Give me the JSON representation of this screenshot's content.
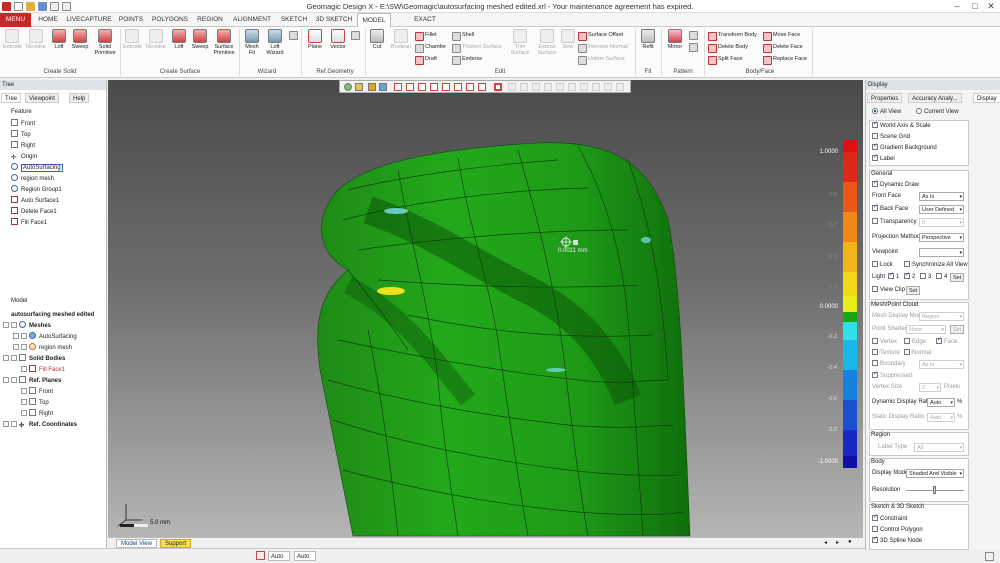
{
  "app": {
    "title": "Geomagic Design X - E:\\SW\\Geomagic\\autosurfacing meshed edited.xrl - Your maintenance agreement has expired."
  },
  "tabs": [
    "MENU",
    "HOME",
    "LIVECAPTURE",
    "POINTS",
    "POLYGONS",
    "REGION",
    "ALIGNMENT",
    "SKETCH",
    "3D SKETCH",
    "MODEL",
    "EXACT SURFACING"
  ],
  "active_tab": "MODEL",
  "ribbon": {
    "create_solid": {
      "label": "Create Solid",
      "buttons": [
        "Extrude",
        "Revolve",
        "Loft",
        "Sweep",
        "Solid Primitive"
      ]
    },
    "create_surface": {
      "label": "Create Surface",
      "buttons": [
        "Extrude",
        "Revolve",
        "Loft",
        "Sweep",
        "Surface Primitive"
      ]
    },
    "wizard": {
      "label": "Wizard",
      "buttons": [
        "Mesh Fit",
        "Loft Wizard"
      ]
    },
    "refgeo": {
      "label": "Ref.Geometry",
      "buttons": [
        "Plane",
        "Vector"
      ]
    },
    "edit": {
      "label": "Edit",
      "big": [
        "Cut",
        "Boolean",
        "Trim Surface",
        "Extend Surface",
        "Sew"
      ],
      "small": [
        "Fillet",
        "Chamfer",
        "Draft",
        "Shell",
        "Thicken Surface",
        "Emboss",
        "Surface Offset",
        "Remove Normal",
        "Untrim Surface"
      ]
    },
    "fit": {
      "label": "Fit",
      "buttons": [
        "Refit"
      ]
    },
    "pattern": {
      "label": "Pattern",
      "buttons": [
        "Mirror"
      ]
    },
    "bodyface": {
      "label": "Body/Face",
      "small": [
        "Transform Body",
        "Delete Body",
        "Split Face",
        "Move Face",
        "Delete Face",
        "Replace Face"
      ]
    }
  },
  "left_panel": {
    "header": "Tree",
    "tabs": [
      "Tree",
      "Viewpoint",
      "Help"
    ],
    "feature_title": "Feature",
    "features": [
      "Front",
      "Top",
      "Right",
      "Origin",
      "AutoSurfacing",
      "region mesh",
      "Region Group1",
      "Auto Surface1",
      "Delete Face1",
      "Fill Face1"
    ],
    "model_title": "Model",
    "model_root": "autosurfacing meshed edited",
    "model": [
      {
        "label": "Meshes",
        "level": 1
      },
      {
        "label": "AutoSurfacing",
        "level": 2
      },
      {
        "label": "region mesh",
        "level": 2
      },
      {
        "label": "Solid Bodies",
        "level": 1
      },
      {
        "label": "Fill Face1",
        "level": 2
      },
      {
        "label": "Ref. Planes",
        "level": 1
      },
      {
        "label": "Front",
        "level": 2
      },
      {
        "label": "Top",
        "level": 2
      },
      {
        "label": "Right",
        "level": 2
      },
      {
        "label": "Ref. Coordinates",
        "level": 1
      }
    ]
  },
  "viewport": {
    "annotation": "0.0011 mm",
    "scale_label": "5.0 mm",
    "colorbar_labels": [
      "1.0000",
      "0.9",
      "0.8",
      "0.7",
      "0.6",
      "0.5",
      "0.4",
      "0.3",
      "0.2",
      "0.1",
      "0.0000",
      "-0.1",
      "-0.2",
      "-0.3",
      "-0.4",
      "-0.5",
      "-0.6",
      "-0.7",
      "-0.8",
      "-0.9",
      "-1.0000"
    ],
    "colorbar_high": "1.0000",
    "colorbar_zero": "0.0000",
    "colorbar_low": "-1.0000"
  },
  "bottom_tabs": [
    "Model View",
    "Support"
  ],
  "status": {
    "field1": "Auto",
    "field2": "Auto"
  },
  "right_panel": {
    "header": "Display",
    "tabs": [
      "Properties",
      "Accuracy Analy...",
      "Display"
    ],
    "view_options": [
      "All View",
      "Current View"
    ],
    "checks": [
      {
        "label": "World Axis & Scale",
        "checked": true
      },
      {
        "label": "Scene Grid",
        "checked": false
      },
      {
        "label": "Gradient Background",
        "checked": true
      },
      {
        "label": "Label",
        "checked": true
      }
    ],
    "general": {
      "title": "General",
      "dynamic_draw": "Dynamic Draw",
      "front_face_label": "Front Face",
      "front_face_value": "As Is",
      "back_face_label": "Back Face",
      "back_face_value": "User Defined",
      "transparency_label": "Transparency",
      "transparency_value": "0",
      "projection_label": "Projection Method",
      "projection_value": "Perspective",
      "viewpoint_label": "Viewpoint",
      "lock": "Lock",
      "sync": "Synchronize All View",
      "light_label": "Light",
      "lights": [
        "1",
        "2",
        "3",
        "4"
      ],
      "set": "Set",
      "view_clip": "View Clip"
    },
    "mesh": {
      "title": "Mesh/Point Cloud",
      "display_mode_label": "Mesh Display Mode",
      "display_mode_value": "Region",
      "point_shader_label": "Point Shader",
      "point_shader_value": "None",
      "opts": [
        "Vertex",
        "Edge",
        "Face",
        "Texture",
        "Normal",
        "Boundary"
      ],
      "boundary_value": "As Is",
      "suppressed": "Suppressed",
      "vertex_size_label": "Vertex Size",
      "vertex_size_value": "2",
      "vertex_size_unit": "Pixels",
      "dyn_ratio_label": "Dynamic Display Ratio",
      "dyn_ratio_value": "Auto",
      "static_ratio_label": "Static Display Ratio",
      "static_ratio_value": "Auto"
    },
    "region": {
      "title": "Region",
      "label_type": "Label Type",
      "label_value": "All"
    },
    "body": {
      "title": "Body",
      "display_mode_label": "Display Mode",
      "display_mode_value": "Shaded And Visible",
      "resolution_label": "Resolution"
    },
    "sketch": {
      "title": "Sketch & 3D Sketch",
      "items": [
        "Constraint",
        "Control Polygon",
        "3D Spline Node"
      ]
    }
  }
}
